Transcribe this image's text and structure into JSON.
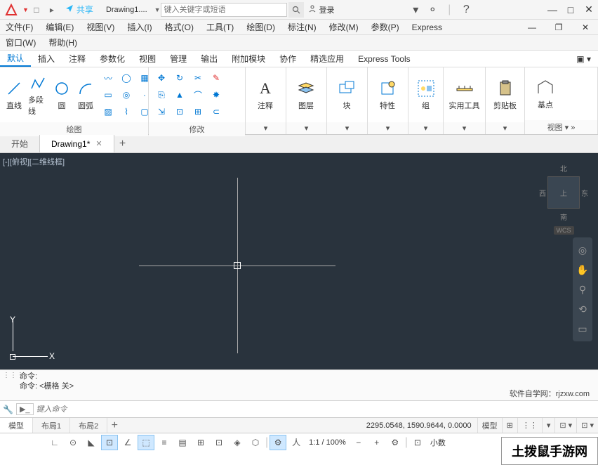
{
  "title": {
    "logo": "A",
    "share": "共享",
    "filename": "Drawing1....",
    "searchPlaceholder": "键入关键字或短语",
    "login": "登录"
  },
  "menu": {
    "file": "文件(F)",
    "edit": "编辑(E)",
    "view": "视图(V)",
    "insert": "插入(I)",
    "format": "格式(O)",
    "tools": "工具(T)",
    "draw": "绘图(D)",
    "dimension": "标注(N)",
    "modify": "修改(M)",
    "param": "参数(P)",
    "express": "Express",
    "window": "窗口(W)",
    "help": "帮助(H)"
  },
  "ribTabs": [
    "默认",
    "插入",
    "注释",
    "参数化",
    "视图",
    "管理",
    "输出",
    "附加模块",
    "协作",
    "精选应用",
    "Express Tools"
  ],
  "panels": {
    "draw": {
      "line": "直线",
      "polyline": "多段线",
      "circle": "圆",
      "arc": "圆弧",
      "label": "绘图"
    },
    "modify": {
      "label": "修改"
    },
    "annotate": {
      "label": "注释"
    },
    "layer": {
      "label": "图层"
    },
    "block": {
      "label": "块"
    },
    "prop": {
      "label": "特性"
    },
    "group": {
      "label": "组"
    },
    "util": {
      "label": "实用工具"
    },
    "clip": {
      "label": "剪贴板"
    },
    "base": {
      "label": "基点",
      "view": "视图"
    }
  },
  "docTabs": {
    "start": "开始",
    "drawing": "Drawing1*"
  },
  "canvas": {
    "info": "[-][俯视][二维线框]",
    "y": "Y",
    "x": "X",
    "north": "北",
    "south": "南",
    "east": "东",
    "west": "西",
    "top": "上",
    "wcs": "WCS"
  },
  "cmd": {
    "h1": "命令:",
    "h2": "命令:  <栅格 关>",
    "inputPlaceholder": "键入命令",
    "watermark": "软件自学网：rjzxw.com"
  },
  "layout": {
    "model": "模型",
    "l1": "布局1",
    "l2": "布局2",
    "coords": "2295.0548, 1590.9644, 0.0000"
  },
  "status": {
    "model": "模型",
    "scale": "1:1 / 100%",
    "decimal": "小数"
  },
  "brand": "土拨鼠手游网"
}
